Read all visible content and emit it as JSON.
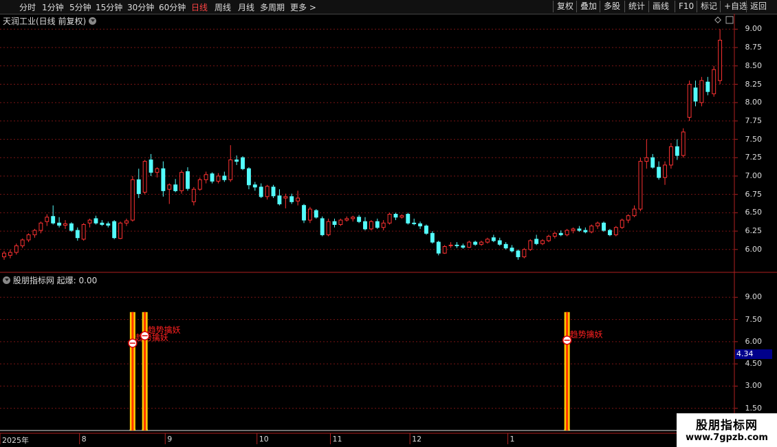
{
  "toolbar": {
    "periods": [
      {
        "label": "分时",
        "active": false
      },
      {
        "label": "1分钟",
        "active": false
      },
      {
        "label": "5分钟",
        "active": false
      },
      {
        "label": "15分钟",
        "active": false
      },
      {
        "label": "30分钟",
        "active": false
      },
      {
        "label": "60分钟",
        "active": false
      },
      {
        "label": "日线",
        "active": true
      },
      {
        "label": "周线",
        "active": false
      },
      {
        "label": "月线",
        "active": false
      },
      {
        "label": "多周期",
        "active": false
      },
      {
        "label": "更多 >",
        "active": false
      }
    ],
    "actions": [
      "复权",
      "叠加",
      "多股",
      "统计",
      "画线",
      "F10",
      "标记",
      "+自选",
      "返回"
    ]
  },
  "main_chart": {
    "title": "天润工业(日线 前复权)",
    "y_labels": [
      "9.00",
      "8.75",
      "8.50",
      "8.25",
      "8.00",
      "7.75",
      "7.50",
      "7.25",
      "7.00",
      "6.75",
      "6.50",
      "6.25",
      "6.00"
    ]
  },
  "indicator": {
    "title": "股朋指标网 起爆: 0.00",
    "y_labels": [
      "9.00",
      "7.50",
      "6.00",
      "4.50",
      "3.00",
      "1.50"
    ],
    "current_value": "4.34",
    "signals": [
      {
        "index": 21,
        "label": "趋势擒妖",
        "value": 5.9
      },
      {
        "index": 23,
        "label": "趋势擒妖",
        "value": 6.4
      },
      {
        "index": 92,
        "label": "趋势擒妖",
        "value": 6.1
      }
    ]
  },
  "x_axis": {
    "labels": [
      {
        "text": "2025年",
        "index": 0
      },
      {
        "text": "8",
        "index": 13
      },
      {
        "text": "9",
        "index": 27
      },
      {
        "text": "10",
        "index": 42
      },
      {
        "text": "11",
        "index": 54
      },
      {
        "text": "12",
        "index": 67
      },
      {
        "text": "1",
        "index": 83
      }
    ]
  },
  "watermark": {
    "line1": "股朋指标网",
    "line2": "www.7gpzb.com"
  },
  "colors": {
    "up": "#ff3232",
    "down": "#54fcfc",
    "grid": "#7a1414",
    "axis": "#b02020",
    "signal": "#ffcc00"
  },
  "chart_data": {
    "type": "candlestick",
    "y_range": [
      5.82,
      9.06
    ],
    "candles": [
      {
        "o": 5.9,
        "h": 5.98,
        "l": 5.86,
        "c": 5.95
      },
      {
        "o": 5.92,
        "h": 6.0,
        "l": 5.88,
        "c": 5.96
      },
      {
        "o": 5.96,
        "h": 6.08,
        "l": 5.93,
        "c": 6.05
      },
      {
        "o": 6.05,
        "h": 6.15,
        "l": 6.02,
        "c": 6.13
      },
      {
        "o": 6.13,
        "h": 6.22,
        "l": 6.1,
        "c": 6.2
      },
      {
        "o": 6.2,
        "h": 6.28,
        "l": 6.16,
        "c": 6.26
      },
      {
        "o": 6.26,
        "h": 6.38,
        "l": 6.22,
        "c": 6.36
      },
      {
        "o": 6.38,
        "h": 6.48,
        "l": 6.32,
        "c": 6.44
      },
      {
        "o": 6.45,
        "h": 6.6,
        "l": 6.34,
        "c": 6.36
      },
      {
        "o": 6.36,
        "h": 6.44,
        "l": 6.3,
        "c": 6.33
      },
      {
        "o": 6.33,
        "h": 6.4,
        "l": 6.28,
        "c": 6.35
      },
      {
        "o": 6.35,
        "h": 6.37,
        "l": 6.24,
        "c": 6.26
      },
      {
        "o": 6.26,
        "h": 6.3,
        "l": 6.12,
        "c": 6.16
      },
      {
        "o": 6.14,
        "h": 6.36,
        "l": 6.12,
        "c": 6.34
      },
      {
        "o": 6.36,
        "h": 6.42,
        "l": 6.3,
        "c": 6.4
      },
      {
        "o": 6.42,
        "h": 6.46,
        "l": 6.34,
        "c": 6.36
      },
      {
        "o": 6.36,
        "h": 6.4,
        "l": 6.32,
        "c": 6.34
      },
      {
        "o": 6.35,
        "h": 6.38,
        "l": 6.3,
        "c": 6.33
      },
      {
        "o": 6.38,
        "h": 6.4,
        "l": 6.14,
        "c": 6.16
      },
      {
        "o": 6.15,
        "h": 6.38,
        "l": 6.14,
        "c": 6.36
      },
      {
        "o": 6.36,
        "h": 6.42,
        "l": 6.32,
        "c": 6.39
      },
      {
        "o": 6.4,
        "h": 7.0,
        "l": 6.38,
        "c": 6.95
      },
      {
        "o": 6.95,
        "h": 7.1,
        "l": 6.7,
        "c": 6.76
      },
      {
        "o": 6.78,
        "h": 7.22,
        "l": 6.75,
        "c": 7.2
      },
      {
        "o": 7.22,
        "h": 7.3,
        "l": 7.0,
        "c": 7.05
      },
      {
        "o": 7.05,
        "h": 7.12,
        "l": 6.98,
        "c": 7.1
      },
      {
        "o": 7.1,
        "h": 7.2,
        "l": 6.72,
        "c": 6.8
      },
      {
        "o": 6.82,
        "h": 6.9,
        "l": 6.62,
        "c": 6.88
      },
      {
        "o": 6.88,
        "h": 6.96,
        "l": 6.78,
        "c": 6.8
      },
      {
        "o": 6.8,
        "h": 7.08,
        "l": 6.76,
        "c": 7.05
      },
      {
        "o": 7.06,
        "h": 7.12,
        "l": 6.8,
        "c": 6.83
      },
      {
        "o": 6.65,
        "h": 6.85,
        "l": 6.6,
        "c": 6.82
      },
      {
        "o": 6.82,
        "h": 6.98,
        "l": 6.8,
        "c": 6.95
      },
      {
        "o": 6.95,
        "h": 7.06,
        "l": 6.9,
        "c": 7.02
      },
      {
        "o": 7.03,
        "h": 7.05,
        "l": 6.9,
        "c": 6.93
      },
      {
        "o": 6.93,
        "h": 7.04,
        "l": 6.9,
        "c": 7.0
      },
      {
        "o": 7.0,
        "h": 7.06,
        "l": 6.92,
        "c": 6.95
      },
      {
        "o": 6.95,
        "h": 7.42,
        "l": 6.92,
        "c": 7.22
      },
      {
        "o": 7.22,
        "h": 7.28,
        "l": 7.15,
        "c": 7.2
      },
      {
        "o": 7.25,
        "h": 7.27,
        "l": 7.08,
        "c": 7.1
      },
      {
        "o": 7.1,
        "h": 7.12,
        "l": 6.82,
        "c": 6.88
      },
      {
        "o": 6.88,
        "h": 6.92,
        "l": 6.8,
        "c": 6.85
      },
      {
        "o": 6.85,
        "h": 6.9,
        "l": 6.7,
        "c": 6.72
      },
      {
        "o": 6.72,
        "h": 6.88,
        "l": 6.68,
        "c": 6.86
      },
      {
        "o": 6.85,
        "h": 6.88,
        "l": 6.7,
        "c": 6.73
      },
      {
        "o": 6.73,
        "h": 6.82,
        "l": 6.6,
        "c": 6.62
      },
      {
        "o": 6.7,
        "h": 6.76,
        "l": 6.56,
        "c": 6.72
      },
      {
        "o": 6.72,
        "h": 6.76,
        "l": 6.62,
        "c": 6.65
      },
      {
        "o": 6.66,
        "h": 6.8,
        "l": 6.6,
        "c": 6.7
      },
      {
        "o": 6.6,
        "h": 6.62,
        "l": 6.36,
        "c": 6.4
      },
      {
        "o": 6.4,
        "h": 6.58,
        "l": 6.36,
        "c": 6.55
      },
      {
        "o": 6.53,
        "h": 6.55,
        "l": 6.42,
        "c": 6.44
      },
      {
        "o": 6.42,
        "h": 6.45,
        "l": 6.18,
        "c": 6.2
      },
      {
        "o": 6.2,
        "h": 6.42,
        "l": 6.18,
        "c": 6.38
      },
      {
        "o": 6.38,
        "h": 6.42,
        "l": 6.3,
        "c": 6.34
      },
      {
        "o": 6.34,
        "h": 6.42,
        "l": 6.32,
        "c": 6.4
      },
      {
        "o": 6.4,
        "h": 6.45,
        "l": 6.38,
        "c": 6.42
      },
      {
        "o": 6.42,
        "h": 6.46,
        "l": 6.38,
        "c": 6.44
      },
      {
        "o": 6.44,
        "h": 6.47,
        "l": 6.36,
        "c": 6.38
      },
      {
        "o": 6.38,
        "h": 6.44,
        "l": 6.26,
        "c": 6.28
      },
      {
        "o": 6.28,
        "h": 6.4,
        "l": 6.26,
        "c": 6.38
      },
      {
        "o": 6.38,
        "h": 6.42,
        "l": 6.28,
        "c": 6.3
      },
      {
        "o": 6.3,
        "h": 6.4,
        "l": 6.26,
        "c": 6.36
      },
      {
        "o": 6.36,
        "h": 6.5,
        "l": 6.34,
        "c": 6.48
      },
      {
        "o": 6.48,
        "h": 6.5,
        "l": 6.4,
        "c": 6.44
      },
      {
        "o": 6.44,
        "h": 6.48,
        "l": 6.42,
        "c": 6.46
      },
      {
        "o": 6.48,
        "h": 6.5,
        "l": 6.34,
        "c": 6.36
      },
      {
        "o": 6.36,
        "h": 6.42,
        "l": 6.33,
        "c": 6.35
      },
      {
        "o": 6.35,
        "h": 6.38,
        "l": 6.28,
        "c": 6.32
      },
      {
        "o": 6.32,
        "h": 6.34,
        "l": 6.2,
        "c": 6.22
      },
      {
        "o": 6.22,
        "h": 6.25,
        "l": 6.08,
        "c": 6.1
      },
      {
        "o": 6.1,
        "h": 6.12,
        "l": 5.92,
        "c": 5.95
      },
      {
        "o": 5.95,
        "h": 6.06,
        "l": 5.94,
        "c": 6.04
      },
      {
        "o": 6.05,
        "h": 6.1,
        "l": 6.02,
        "c": 6.06
      },
      {
        "o": 6.06,
        "h": 6.1,
        "l": 6.02,
        "c": 6.05
      },
      {
        "o": 6.05,
        "h": 6.08,
        "l": 6.01,
        "c": 6.03
      },
      {
        "o": 6.03,
        "h": 6.12,
        "l": 6.02,
        "c": 6.1
      },
      {
        "o": 6.1,
        "h": 6.12,
        "l": 6.05,
        "c": 6.07
      },
      {
        "o": 6.07,
        "h": 6.12,
        "l": 6.05,
        "c": 6.1
      },
      {
        "o": 6.1,
        "h": 6.16,
        "l": 6.08,
        "c": 6.14
      },
      {
        "o": 6.16,
        "h": 6.2,
        "l": 6.1,
        "c": 6.12
      },
      {
        "o": 6.12,
        "h": 6.16,
        "l": 6.05,
        "c": 6.07
      },
      {
        "o": 6.07,
        "h": 6.1,
        "l": 6.0,
        "c": 6.02
      },
      {
        "o": 6.02,
        "h": 6.06,
        "l": 5.96,
        "c": 5.98
      },
      {
        "o": 5.98,
        "h": 6.0,
        "l": 5.86,
        "c": 5.9
      },
      {
        "o": 5.9,
        "h": 6.02,
        "l": 5.88,
        "c": 6.0
      },
      {
        "o": 6.0,
        "h": 6.14,
        "l": 5.98,
        "c": 6.12
      },
      {
        "o": 6.14,
        "h": 6.2,
        "l": 6.06,
        "c": 6.08
      }
    ],
    "candles_late": [
      {
        "o": 6.08,
        "h": 6.14,
        "l": 6.06,
        "c": 6.12
      },
      {
        "o": 6.12,
        "h": 6.2,
        "l": 6.1,
        "c": 6.18
      },
      {
        "o": 6.18,
        "h": 6.24,
        "l": 6.15,
        "c": 6.22
      },
      {
        "o": 6.22,
        "h": 6.26,
        "l": 6.18,
        "c": 6.2
      },
      {
        "o": 6.2,
        "h": 6.28,
        "l": 6.18,
        "c": 6.26
      },
      {
        "o": 6.26,
        "h": 6.3,
        "l": 6.22,
        "c": 6.28
      },
      {
        "o": 6.28,
        "h": 6.32,
        "l": 6.24,
        "c": 6.26
      },
      {
        "o": 6.26,
        "h": 6.3,
        "l": 6.22,
        "c": 6.24
      },
      {
        "o": 6.24,
        "h": 6.34,
        "l": 6.22,
        "c": 6.32
      },
      {
        "o": 6.32,
        "h": 6.38,
        "l": 6.28,
        "c": 6.36
      },
      {
        "o": 6.36,
        "h": 6.38,
        "l": 6.24,
        "c": 6.26
      },
      {
        "o": 6.26,
        "h": 6.28,
        "l": 6.18,
        "c": 6.2
      },
      {
        "o": 6.2,
        "h": 6.32,
        "l": 6.18,
        "c": 6.3
      },
      {
        "o": 6.3,
        "h": 6.42,
        "l": 6.28,
        "c": 6.4
      },
      {
        "o": 6.4,
        "h": 6.48,
        "l": 6.36,
        "c": 6.46
      },
      {
        "o": 6.46,
        "h": 6.6,
        "l": 6.44,
        "c": 6.55
      },
      {
        "o": 6.55,
        "h": 7.25,
        "l": 6.52,
        "c": 7.2
      },
      {
        "o": 7.2,
        "h": 7.5,
        "l": 7.1,
        "c": 7.25
      },
      {
        "o": 7.25,
        "h": 7.3,
        "l": 7.1,
        "c": 7.12
      },
      {
        "o": 7.12,
        "h": 7.2,
        "l": 6.95,
        "c": 6.98
      },
      {
        "o": 6.98,
        "h": 7.2,
        "l": 6.88,
        "c": 7.15
      },
      {
        "o": 7.15,
        "h": 7.45,
        "l": 7.1,
        "c": 7.4
      },
      {
        "o": 7.4,
        "h": 7.5,
        "l": 7.22,
        "c": 7.28
      },
      {
        "o": 7.28,
        "h": 7.65,
        "l": 7.25,
        "c": 7.6
      },
      {
        "o": 7.8,
        "h": 8.3,
        "l": 7.75,
        "c": 8.25
      },
      {
        "o": 8.2,
        "h": 8.3,
        "l": 7.95,
        "c": 8.02
      },
      {
        "o": 8.0,
        "h": 8.35,
        "l": 7.95,
        "c": 8.3
      },
      {
        "o": 8.28,
        "h": 8.35,
        "l": 8.1,
        "c": 8.15
      },
      {
        "o": 8.12,
        "h": 8.5,
        "l": 8.08,
        "c": 8.45
      },
      {
        "o": 8.3,
        "h": 9.0,
        "l": 8.25,
        "c": 8.85
      }
    ]
  }
}
